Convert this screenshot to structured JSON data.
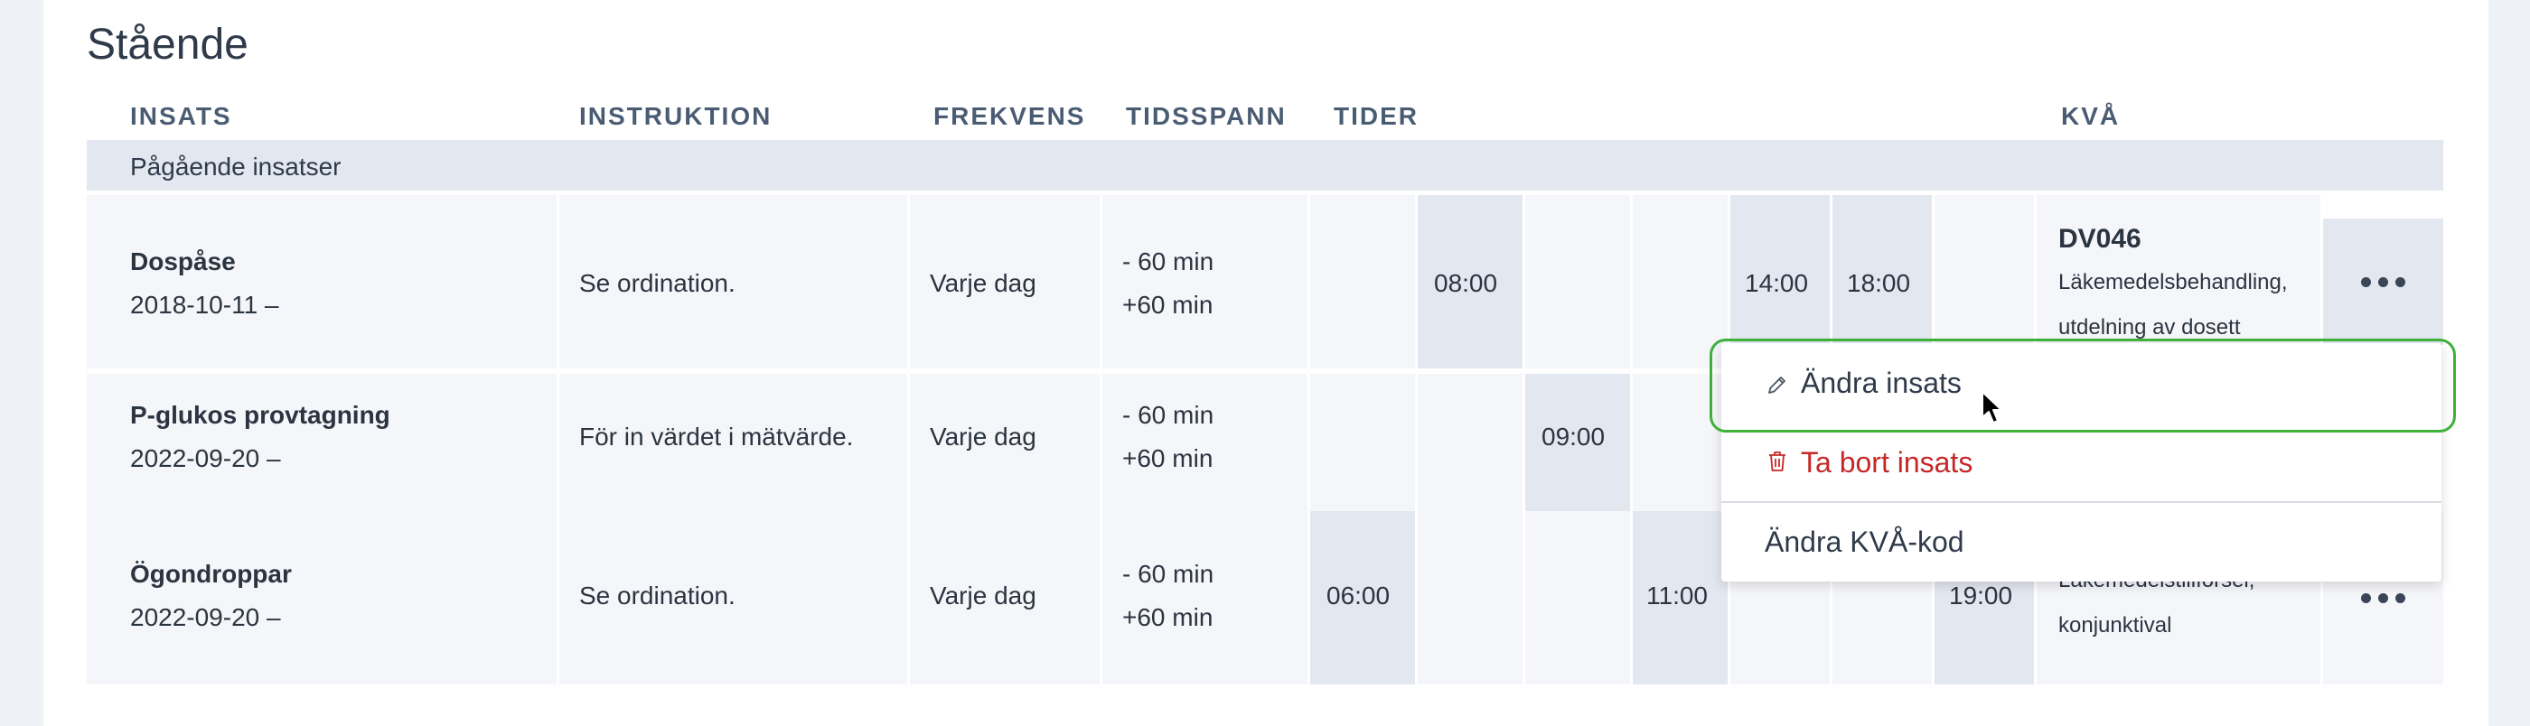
{
  "section_title": "Stående",
  "columns": {
    "insats": "INSATS",
    "instruktion": "INSTRUKTION",
    "frekvens": "FREKVENS",
    "tidsspann": "TIDSSPANN",
    "tider": "TIDER",
    "kva": "KVÅ"
  },
  "group_label": "Pågående insatser",
  "rows": [
    {
      "name": "Dospåse",
      "date": "2018-10-11 –",
      "instruction": "Se ordination.",
      "frequency": "Varje dag",
      "span_before": "- 60 min",
      "span_after": "+60 min",
      "times": {
        "t08": "08:00",
        "t14": "14:00",
        "t18": "18:00"
      },
      "kva_code": "DV046",
      "kva_desc_1": "Läkemedelsbehandling,",
      "kva_desc_2": "utdelning av dosett"
    },
    {
      "name": "P-glukos provtagning",
      "date": "2022-09-20 –",
      "instruction": "För in värdet i mätvärde.",
      "frequency": "Varje dag",
      "span_before": "- 60 min",
      "span_after": "+60 min",
      "times": {
        "t09": "09:00"
      }
    },
    {
      "name": "Ögondroppar",
      "date": "2022-09-20 –",
      "instruction": "Se ordination.",
      "frequency": "Varje dag",
      "span_before": "- 60 min",
      "span_after": "+60 min",
      "times": {
        "t06": "06:00",
        "t11": "11:00",
        "t19": "19:00"
      },
      "kva_desc_1": "Läkemedelstillförsel,",
      "kva_desc_2": "konjunktival"
    }
  ],
  "menu": {
    "edit_label": "Ändra insats",
    "delete_label": "Ta bort insats",
    "change_kva_label": "Ändra KVÅ-kod",
    "edit_icon": "pencil-icon",
    "delete_icon": "trash-icon"
  },
  "colors": {
    "delete": "#c62828",
    "focus": "#3db13a",
    "highlight_cell": "#e3e7ef"
  }
}
